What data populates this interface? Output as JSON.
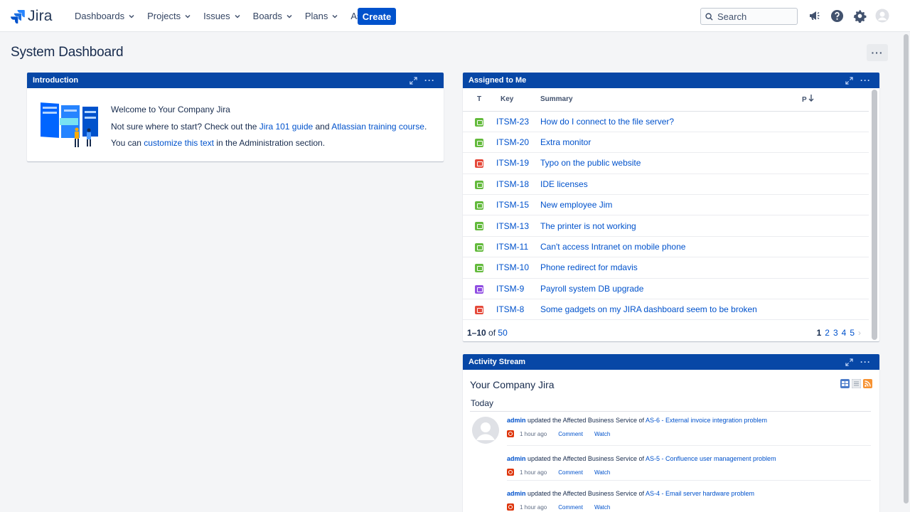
{
  "app": {
    "name": "Jira"
  },
  "nav": {
    "items": [
      {
        "label": "Dashboards"
      },
      {
        "label": "Projects"
      },
      {
        "label": "Issues"
      },
      {
        "label": "Boards"
      },
      {
        "label": "Plans"
      },
      {
        "label": "Assets"
      }
    ],
    "create_label": "Create",
    "search_placeholder": "Search"
  },
  "page": {
    "title": "System Dashboard",
    "menu": "···"
  },
  "intro": {
    "title": "Introduction",
    "line1": "Welcome to Your Company Jira",
    "line2_prefix": "Not sure where to start? Check out the ",
    "line2_link1": "Jira 101 guide",
    "line2_mid": " and ",
    "line2_link2": "Atlassian training course",
    "line2_suffix": ".",
    "line3_prefix": "You can ",
    "line3_link": "customize this text",
    "line3_suffix": " in the Administration section."
  },
  "assigned": {
    "title": "Assigned to Me",
    "columns": {
      "t": "T",
      "key": "Key",
      "summary": "Summary",
      "p": "P"
    },
    "rows": [
      {
        "type": "service",
        "key": "ITSM-23",
        "summary": "How do I connect to the file server?"
      },
      {
        "type": "service",
        "key": "ITSM-20",
        "summary": "Extra monitor"
      },
      {
        "type": "incident",
        "key": "ITSM-19",
        "summary": "Typo on the public website"
      },
      {
        "type": "service",
        "key": "ITSM-18",
        "summary": "IDE licenses"
      },
      {
        "type": "service",
        "key": "ITSM-15",
        "summary": "New employee Jim"
      },
      {
        "type": "service",
        "key": "ITSM-13",
        "summary": "The printer is not working"
      },
      {
        "type": "service",
        "key": "ITSM-11",
        "summary": "Can't access Intranet on mobile phone"
      },
      {
        "type": "service",
        "key": "ITSM-10",
        "summary": "Phone redirect for mdavis"
      },
      {
        "type": "change",
        "key": "ITSM-9",
        "summary": "Payroll system DB upgrade"
      },
      {
        "type": "incident",
        "key": "ITSM-8",
        "summary": "Some gadgets on my JIRA dashboard seem to be broken"
      }
    ],
    "pager": {
      "range": "1–10",
      "of": "of",
      "total": "50",
      "pages": [
        "1",
        "2",
        "3",
        "4",
        "5"
      ],
      "current": "1"
    }
  },
  "activity": {
    "title": "Activity Stream",
    "stream_title": "Your Company Jira",
    "section": "Today",
    "entries": [
      {
        "user": "admin",
        "action": " updated the Affected Business Service of ",
        "issue": "AS-6 - External invoice integration problem",
        "time": "1 hour ago",
        "comment": "Comment",
        "watch": "Watch"
      },
      {
        "user": "admin",
        "action": " updated the Affected Business Service of ",
        "issue": "AS-5 - Confluence user management problem",
        "time": "1 hour ago",
        "comment": "Comment",
        "watch": "Watch"
      },
      {
        "user": "admin",
        "action": " updated the Affected Business Service of ",
        "issue": "AS-4 - Email server hardware problem",
        "time": "1 hour ago",
        "comment": "Comment",
        "watch": "Watch"
      }
    ]
  },
  "colors": {
    "brand_blue": "#0052cc",
    "gadget_header": "#0747a6",
    "service_type": "#63ba3c",
    "incident_type": "#e5493a",
    "change_type": "#904ee2"
  }
}
